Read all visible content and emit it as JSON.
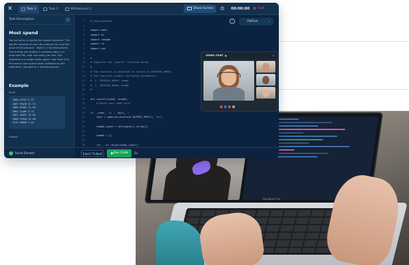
{
  "topbar": {
    "tabs": [
      {
        "label": "Task 1"
      },
      {
        "label": "Task 2"
      },
      {
        "label": "Whiteboard 1"
      }
    ],
    "share_label": "Share Screen",
    "timer": "00:00:00",
    "exit_label": "Exit Interview"
  },
  "task_panel": {
    "header": "Task Description",
    "title": "Most spend",
    "description": "You are given a log file for bought products. The log file consists of user ids, product ids, and the price of the product – float in 2 decimal places. The entries are written in random order in a plain text file, with one entry per line. The objective is a single white space. Your task is to find which user spend most, followed by the total/float, rounded to 2 decimal places.",
    "example_title": "Example",
    "input_label": "Input",
    "input_lines": [
      "1006 e7f91 2.37",
      "1007 93a10 32.73",
      "1006 d9402 22.98",
      "2084 11d8d 5.75",
      "1001 185f2 75.94",
      "1008 ff940 32.98",
      "7014 48689 2.44"
    ],
    "output_label": "Output",
    "user_name": "Sarah Earnest"
  },
  "editor": {
    "language": "Python",
    "lines": [
      {
        "n": "1",
        "t": "#!/bin/python3",
        "k": "cmt"
      },
      {
        "n": "2",
        "t": "",
        "k": ""
      },
      {
        "n": "3",
        "t": "import math",
        "k": ""
      },
      {
        "n": "4",
        "t": "import os",
        "k": ""
      },
      {
        "n": "5",
        "t": "import random",
        "k": ""
      },
      {
        "n": "6",
        "t": "import re",
        "k": ""
      },
      {
        "n": "7",
        "t": "import sys",
        "k": ""
      },
      {
        "n": "8",
        "t": "",
        "k": ""
      },
      {
        "n": "9",
        "t": "#",
        "k": "cmt"
      },
      {
        "n": "10",
        "t": "# Complete the 'counts' function below.",
        "k": "cmt"
      },
      {
        "n": "11",
        "t": "#",
        "k": "cmt"
      },
      {
        "n": "12",
        "t": "# The function is expected to return an INTEGER_ARRAY.",
        "k": "cmt"
      },
      {
        "n": "13",
        "t": "# The function accepts following parameters:",
        "k": "cmt"
      },
      {
        "n": "14",
        "t": "#  1. INTEGER_ARRAY teamA",
        "k": "cmt"
      },
      {
        "n": "15",
        "t": "#  2. INTEGER_ARRAY teamB",
        "k": "cmt"
      },
      {
        "n": "16",
        "t": "#",
        "k": "cmt"
      },
      {
        "n": "17",
        "t": "",
        "k": ""
      },
      {
        "n": "18",
        "t": "def counts(teamA, teamB):",
        "k": "kw"
      },
      {
        "n": "19",
        "t": "    # Write your code here",
        "k": "cmt"
      },
      {
        "n": "20",
        "t": "",
        "k": ""
      },
      {
        "n": "21",
        "t": "if __name__ == '__main__':",
        "k": "kw"
      },
      {
        "n": "22",
        "t": "    fptr = open(os.environ['OUTPUT_PATH'], 'w')",
        "k": ""
      },
      {
        "n": "23",
        "t": "",
        "k": ""
      },
      {
        "n": "24",
        "t": "    teamA_count = int(input().strip())",
        "k": ""
      },
      {
        "n": "25",
        "t": "",
        "k": ""
      },
      {
        "n": "26",
        "t": "    teamA = []",
        "k": ""
      },
      {
        "n": "27",
        "t": "",
        "k": ""
      },
      {
        "n": "28",
        "t": "    for _ in range(teamA_count):",
        "k": "kw"
      },
      {
        "n": "29",
        "t": "        teamA_item = int(input().strip())",
        "k": ""
      },
      {
        "n": "30",
        "t": "        teamA.append(teamA_item)",
        "k": ""
      }
    ]
  },
  "controls": {
    "io_label": "Input / Output",
    "run_label": "Run Code",
    "submit_short": "Su"
  },
  "video": {
    "title": "VIDEO CHAT"
  },
  "photo": {
    "brand_label": "MacBook Pro"
  },
  "colors": {
    "ide_bg": "#0d2742",
    "accent_green": "#1aa35b",
    "exit_red": "#ff5d5d"
  }
}
